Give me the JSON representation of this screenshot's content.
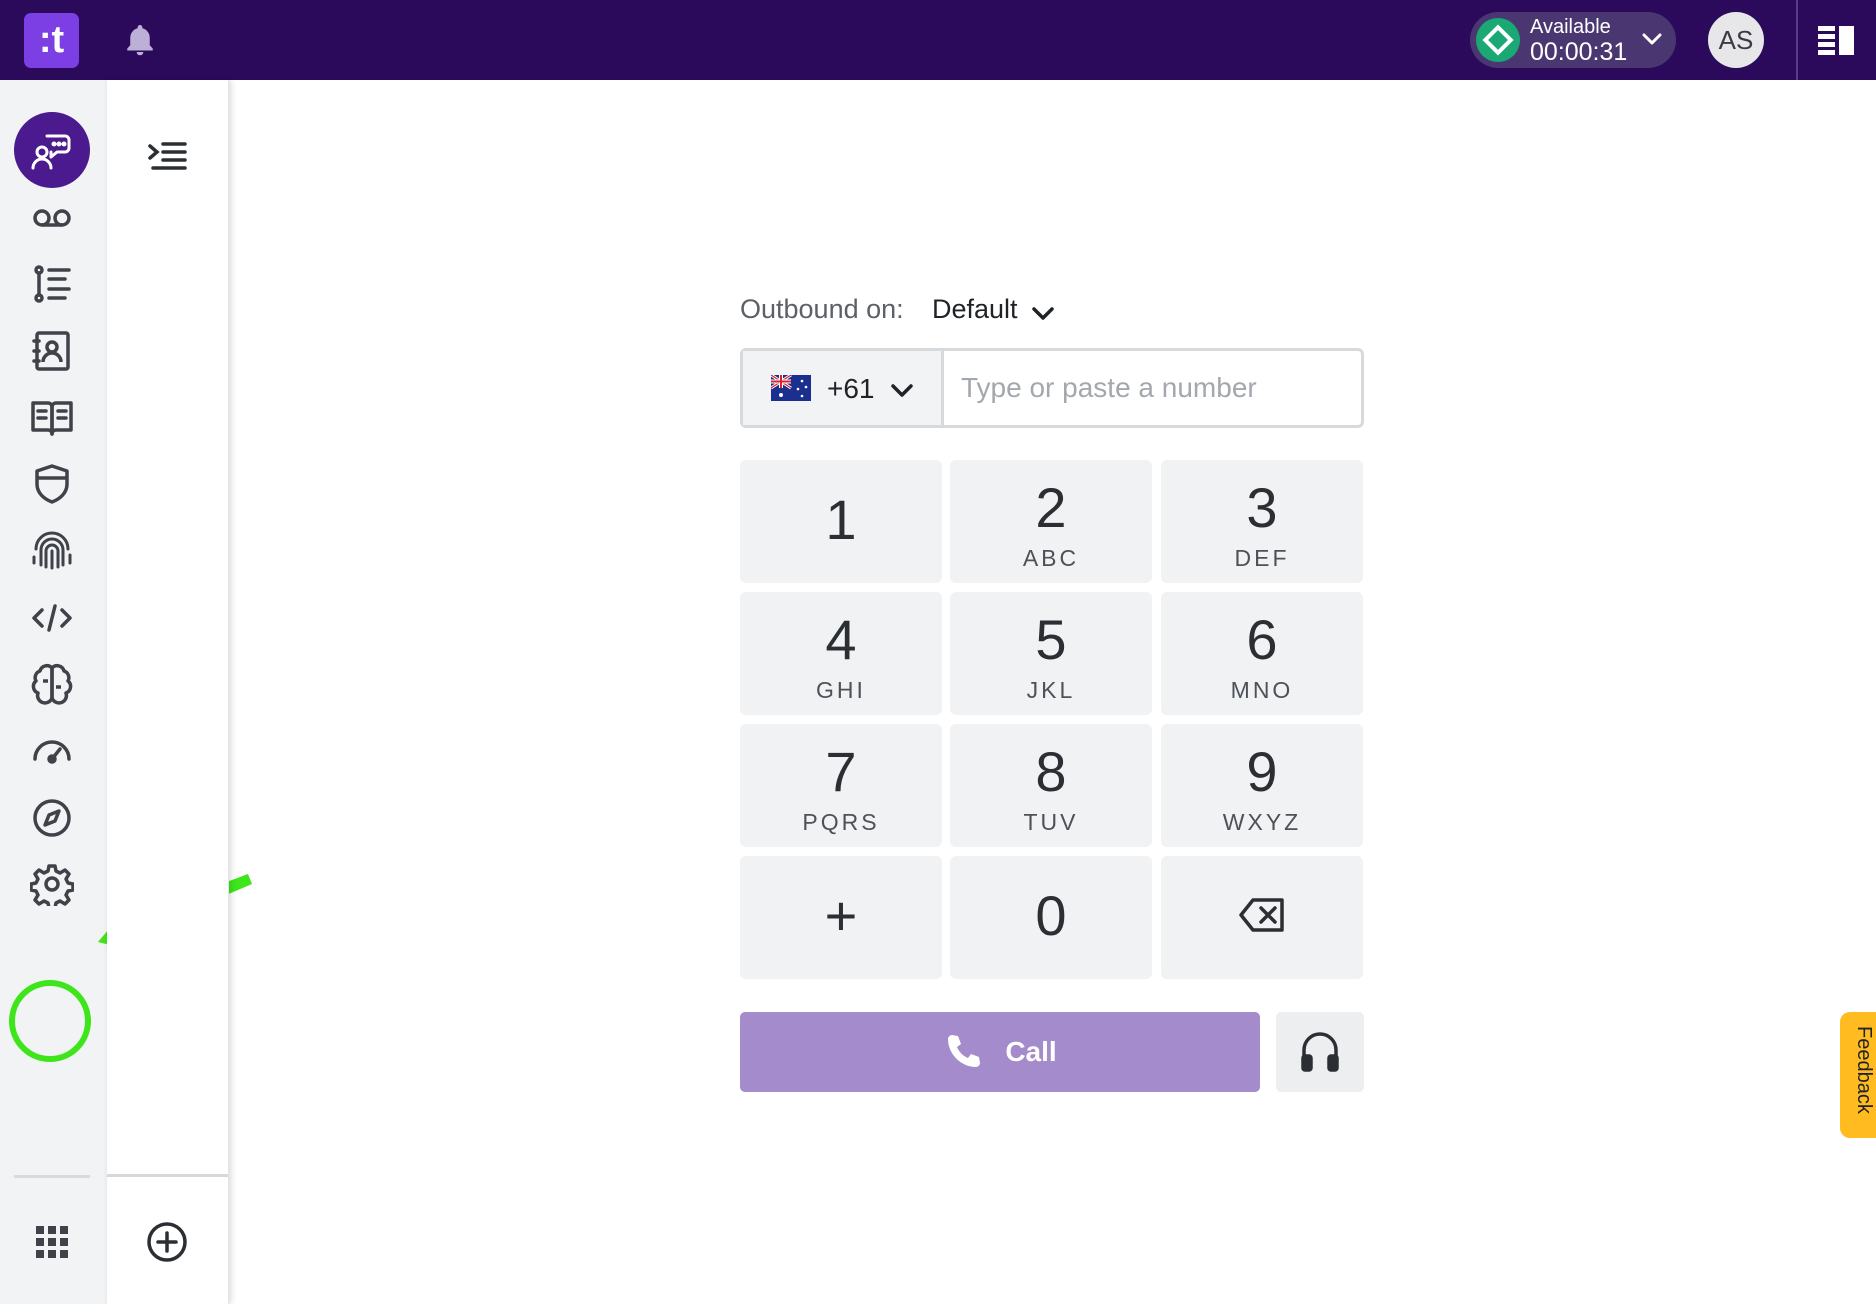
{
  "topbar": {
    "logo_text": ":t",
    "status_label": "Available",
    "status_timer": "00:00:31",
    "status_color": "#1aa874",
    "user_initials": "AS",
    "brand_bg": "#2b0a5c"
  },
  "nav_rail": {
    "items": [
      {
        "icon": "chat-agent-icon",
        "active": true
      },
      {
        "icon": "voicemail-icon"
      },
      {
        "icon": "list-numbered-icon"
      },
      {
        "icon": "contact-book-icon"
      },
      {
        "icon": "open-book-icon"
      },
      {
        "icon": "shield-icon"
      },
      {
        "icon": "fingerprint-icon"
      },
      {
        "icon": "code-icon"
      },
      {
        "icon": "brain-icon"
      },
      {
        "icon": "speedometer-icon"
      },
      {
        "icon": "compass-icon",
        "highlighted": true
      },
      {
        "icon": "settings-icon"
      }
    ],
    "bottom_icon": "app-grid-icon",
    "highlight_color": "#3ee51a"
  },
  "panel": {
    "collapse_icon": "collapse-menu-icon",
    "add_icon": "add-circle-icon"
  },
  "dialer": {
    "outbound_label": "Outbound on:",
    "outbound_value": "Default",
    "country_flag": "australia-flag-icon",
    "country_code": "+61",
    "number_placeholder": "Type or paste a number",
    "number_value": "",
    "keys": [
      {
        "digit": "1",
        "letters": ""
      },
      {
        "digit": "2",
        "letters": "ABC"
      },
      {
        "digit": "3",
        "letters": "DEF"
      },
      {
        "digit": "4",
        "letters": "GHI"
      },
      {
        "digit": "5",
        "letters": "JKL"
      },
      {
        "digit": "6",
        "letters": "MNO"
      },
      {
        "digit": "7",
        "letters": "PQRS"
      },
      {
        "digit": "8",
        "letters": "TUV"
      },
      {
        "digit": "9",
        "letters": "WXYZ"
      },
      {
        "digit": "+",
        "letters": ""
      },
      {
        "digit": "0",
        "letters": ""
      }
    ],
    "backspace_icon": "backspace-icon",
    "call_label": "Call",
    "call_color": "#a48bcc",
    "headset_icon": "headset-icon"
  },
  "feedback": {
    "label": "Feedback",
    "color": "#ffbb1f"
  }
}
